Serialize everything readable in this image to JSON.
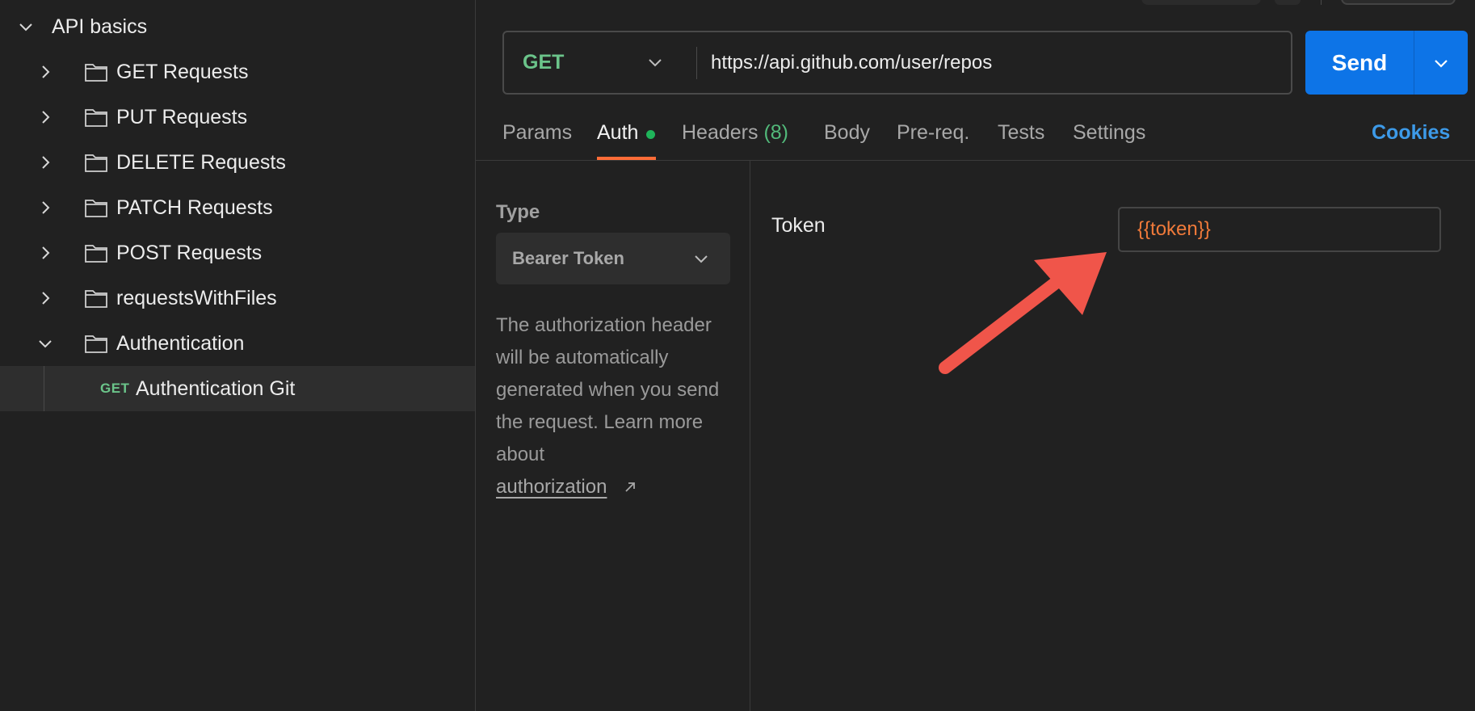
{
  "sidebar": {
    "collection": "API basics",
    "folders": [
      {
        "label": "GET Requests"
      },
      {
        "label": "PUT Requests"
      },
      {
        "label": "DELETE Requests"
      },
      {
        "label": "PATCH Requests"
      },
      {
        "label": "POST Requests"
      },
      {
        "label": "requestsWithFiles"
      },
      {
        "label": "Authentication"
      }
    ],
    "selected_request": {
      "method": "GET",
      "label": "Authentication Git"
    }
  },
  "request": {
    "method": "GET",
    "url": "https://api.github.com/user/repos",
    "send_label": "Send"
  },
  "tabs": {
    "params": "Params",
    "auth": "Auth",
    "headers": "Headers",
    "headers_count": "(8)",
    "body": "Body",
    "prereq": "Pre-req.",
    "tests": "Tests",
    "settings": "Settings",
    "cookies": "Cookies"
  },
  "auth": {
    "type_label": "Type",
    "type_value": "Bearer Token",
    "description": "The authorization header will be automatically generated when you send the request. Learn more about",
    "link_text": "authorization",
    "token_label": "Token",
    "token_value": "{{token}}"
  },
  "colors": {
    "accent": "#ff6c37",
    "send": "#0d74e7",
    "method_get": "#6bc48a",
    "variable": "#f07a3a",
    "arrow": "#f0554a"
  },
  "icons": [
    "chevron-down-icon",
    "chevron-right-icon",
    "folder-icon",
    "external-link-icon"
  ]
}
